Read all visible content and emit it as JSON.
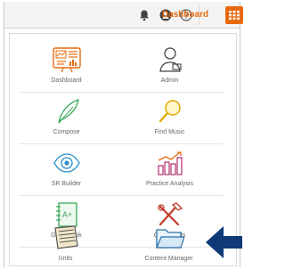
{
  "header": {
    "dashboard_label": "Dashboard",
    "icons": [
      "bell-icon",
      "user-icon",
      "help-icon",
      "grid-icon"
    ],
    "accent_color": "#e8690e"
  },
  "menu": {
    "items": [
      {
        "label": "Dashboard",
        "icon": "dashboard-icon"
      },
      {
        "label": "Admin",
        "icon": "admin-icon"
      },
      {
        "label": "Compose",
        "icon": "feather-icon"
      },
      {
        "label": "Find Music",
        "icon": "magnifier-icon"
      },
      {
        "label": "SR Builder",
        "icon": "eye-icon"
      },
      {
        "label": "Practice Analysis",
        "icon": "chart-icon"
      },
      {
        "label": "Gradebook",
        "icon": "gradebook-icon"
      },
      {
        "label": "Class Tools",
        "icon": "tools-icon"
      },
      {
        "label": "Units",
        "icon": "units-icon"
      },
      {
        "label": "Content Manager",
        "icon": "folder-icon"
      }
    ]
  },
  "annotation": {
    "arrow_color": "#0f3a78"
  }
}
